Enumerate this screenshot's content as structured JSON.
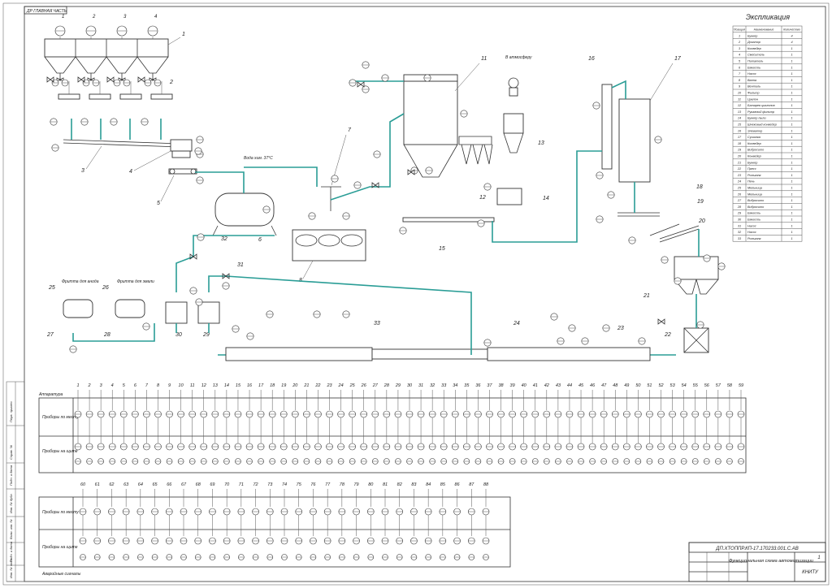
{
  "stamp_top": "ДР ГЛАВНАЯ ЧАСТЬ",
  "outlet_label_1": "В атмосферу",
  "pipe_label_1": "Вода хим. 37°С",
  "tank_label_25": "Фритта для анода",
  "tank_label_26": "Фритта для эмали",
  "explication": {
    "title": "Экспликация",
    "headers": [
      "Позиция",
      "Наименование",
      "Количество"
    ],
    "rows": [
      [
        "1",
        "Бункер",
        "4"
      ],
      [
        "2",
        "Дозатор",
        "4"
      ],
      [
        "3",
        "Конвейер",
        "1"
      ],
      [
        "4",
        "Смеситель",
        "1"
      ],
      [
        "5",
        "Питатель",
        "1"
      ],
      [
        "6",
        "Емкость",
        "1"
      ],
      [
        "7",
        "Насос",
        "1"
      ],
      [
        "8",
        "Ванна",
        "1"
      ],
      [
        "9",
        "Вентиль",
        "1"
      ],
      [
        "10",
        "Фильтр",
        "1"
      ],
      [
        "11",
        "Циклон",
        "1"
      ],
      [
        "12",
        "Батарея циклонов",
        "1"
      ],
      [
        "13",
        "Рукавный фильтр",
        "1"
      ],
      [
        "14",
        "Бункер пыли",
        "1"
      ],
      [
        "15",
        "Шнековый конвейер",
        "1"
      ],
      [
        "16",
        "Элеватор",
        "1"
      ],
      [
        "17",
        "Сушилка",
        "1"
      ],
      [
        "18",
        "Конвейер",
        "1"
      ],
      [
        "19",
        "Вибросито",
        "1"
      ],
      [
        "20",
        "Конвейер",
        "1"
      ],
      [
        "21",
        "Бункер",
        "1"
      ],
      [
        "22",
        "Пресс",
        "1"
      ],
      [
        "23",
        "Рольганг",
        "1"
      ],
      [
        "24",
        "Печь",
        "1"
      ],
      [
        "25",
        "Мельница",
        "1"
      ],
      [
        "26",
        "Мельница",
        "1"
      ],
      [
        "27",
        "Вибросито",
        "1"
      ],
      [
        "28",
        "Вибросито",
        "1"
      ],
      [
        "29",
        "Емкость",
        "1"
      ],
      [
        "30",
        "Емкость",
        "1"
      ],
      [
        "31",
        "Насос",
        "1"
      ],
      [
        "32",
        "Насос",
        "1"
      ],
      [
        "33",
        "Рольганг",
        "1"
      ]
    ]
  },
  "control_panel_1": {
    "title": "Аппаратура",
    "row_labels": [
      "Приборы по месту",
      "Приборы на щите"
    ],
    "numbers": [
      "1",
      "2",
      "3",
      "4",
      "5",
      "6",
      "7",
      "8",
      "9",
      "10",
      "11",
      "12",
      "13",
      "14",
      "15",
      "16",
      "17",
      "18",
      "19",
      "20",
      "21",
      "22",
      "23",
      "24",
      "25",
      "26",
      "27",
      "28",
      "29",
      "30",
      "31",
      "32",
      "33",
      "34",
      "35",
      "36",
      "37",
      "38",
      "39",
      "40",
      "41",
      "42",
      "43",
      "44",
      "45",
      "46",
      "47",
      "48",
      "49",
      "50",
      "51",
      "52",
      "53",
      "54",
      "55",
      "56",
      "57",
      "58",
      "59"
    ]
  },
  "control_panel_2": {
    "row_labels": [
      "Приборы по месту",
      "Приборы на щите"
    ],
    "numbers": [
      "60",
      "61",
      "62",
      "63",
      "64",
      "65",
      "66",
      "67",
      "68",
      "69",
      "70",
      "71",
      "72",
      "73",
      "74",
      "75",
      "76",
      "77",
      "78",
      "79",
      "80",
      "81",
      "82",
      "83",
      "84",
      "85",
      "86",
      "87",
      "88"
    ],
    "footnote": "Аварийные сигналы"
  },
  "title_block": {
    "doc_code": "ДП.ХТОППР.КП-17.170233.001.С.АВ",
    "title": "Функциональная схема автоматизации",
    "org": "КНИТУ",
    "sheet": "1"
  },
  "side_stamp_labels": [
    "Перв. примен.",
    "Справ. №",
    "Подп. и дата",
    "Инв. № дубл.",
    "Взам. инв. №",
    "Подп. и дата",
    "Инв. № подл."
  ],
  "colors": {
    "pipe": "#2a9d96",
    "line": "#333333"
  }
}
